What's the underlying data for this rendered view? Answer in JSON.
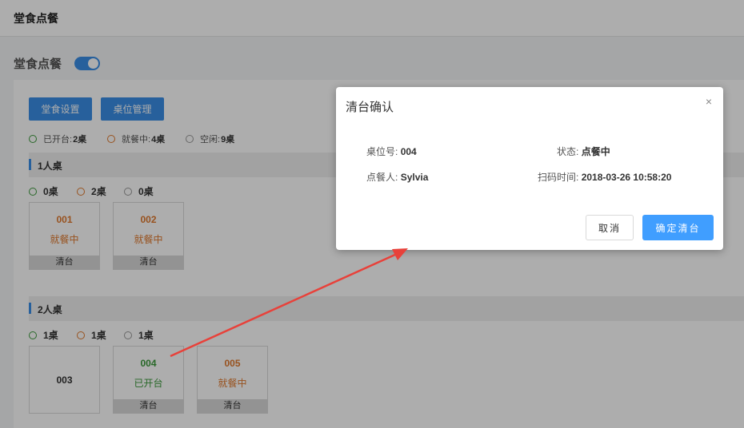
{
  "header": {
    "title": "堂食点餐"
  },
  "section": {
    "title": "堂食点餐"
  },
  "toolbar": {
    "settings_label": "堂食设置",
    "tables_label": "桌位管理"
  },
  "legend": {
    "open_label": "已开台:",
    "open_count": "2桌",
    "dining_label": "就餐中:",
    "dining_count": "4桌",
    "idle_label": "空闲:",
    "idle_count": "9桌"
  },
  "groups": [
    {
      "label": "1人桌",
      "counts": [
        "0桌",
        "2桌",
        "0桌"
      ],
      "tables": [
        {
          "no": "001",
          "status": "就餐中",
          "action": "清台"
        },
        {
          "no": "002",
          "status": "就餐中",
          "action": "清台"
        }
      ]
    },
    {
      "label": "2人桌",
      "counts": [
        "1桌",
        "1桌",
        "1桌"
      ],
      "tables": [
        {
          "no": "003",
          "status": "",
          "action": ""
        },
        {
          "no": "004",
          "status": "已开台",
          "action": "清台"
        },
        {
          "no": "005",
          "status": "就餐中",
          "action": "清台"
        }
      ]
    }
  ],
  "modal": {
    "title": "清台确认",
    "close": "×",
    "table_no_label": "桌位号:",
    "table_no": "004",
    "status_label": "状态:",
    "status": "点餐中",
    "customer_label": "点餐人:",
    "customer": "Sylvia",
    "scan_time_label": "扫码时间:",
    "scan_time": "2018-03-26 10:58:20",
    "cancel_label": "取消",
    "confirm_label": "确定清台"
  },
  "colors": {
    "accent": "#3a8ee6",
    "open": "#3c9a3c",
    "dining": "#e07a2e",
    "arrow": "#e8413a"
  }
}
